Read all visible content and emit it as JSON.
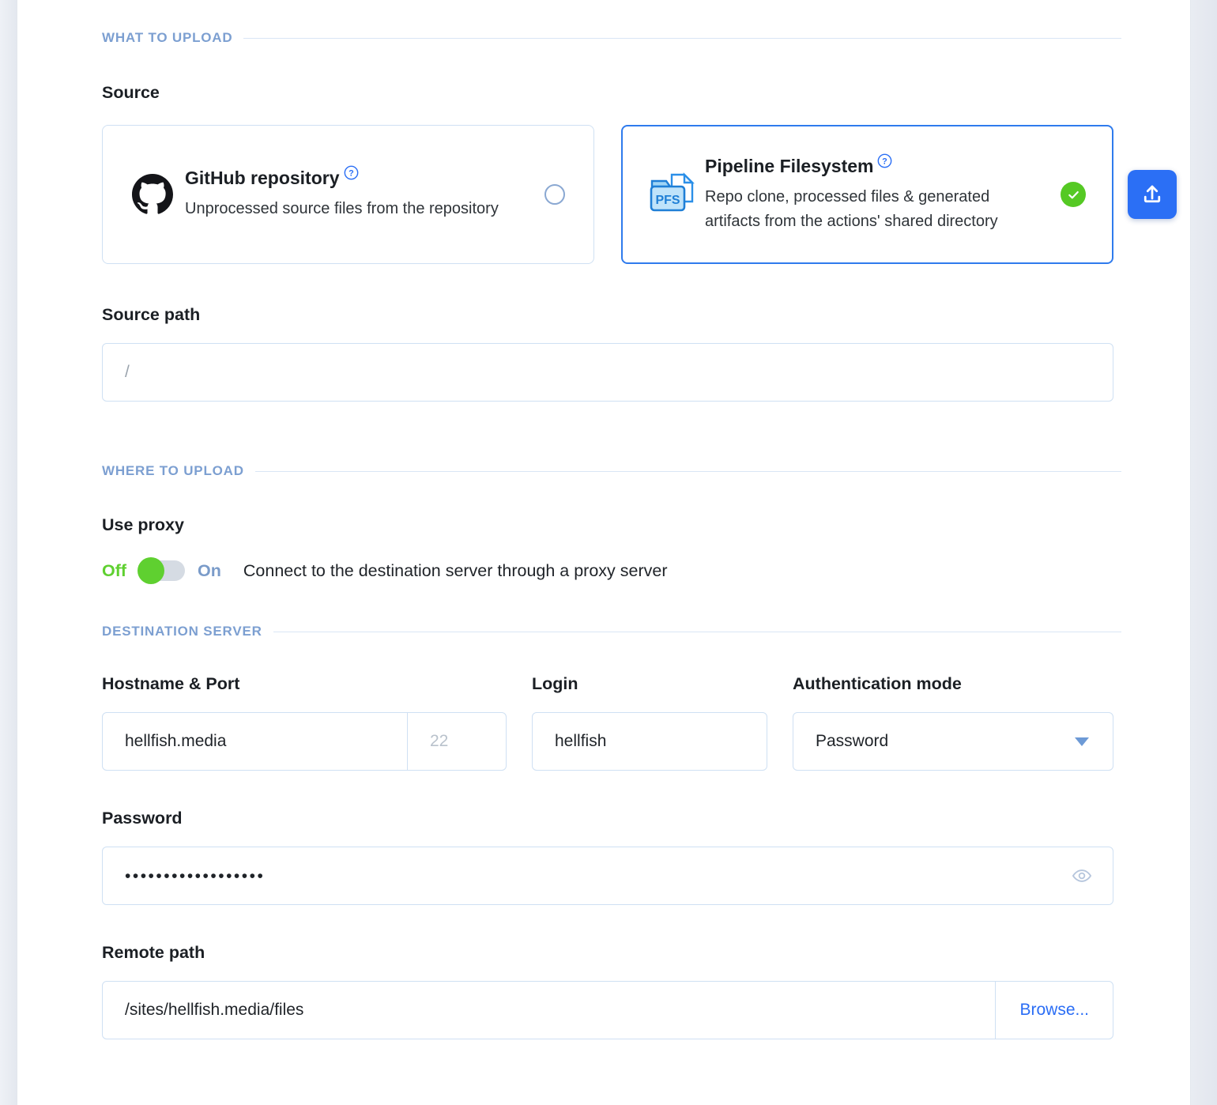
{
  "sections": {
    "what_to_upload": "WHAT TO UPLOAD",
    "where_to_upload": "WHERE TO UPLOAD",
    "destination_server": "DESTINATION SERVER"
  },
  "source": {
    "label": "Source",
    "options": [
      {
        "title": "GitHub repository",
        "description": "Unprocessed source files from the repository",
        "icon": "github-icon",
        "help_icon": "help-circle-icon",
        "selected": false,
        "state_icon": "radio-unchecked-icon"
      },
      {
        "title": "Pipeline Filesystem",
        "description": "Repo clone, processed files & generated artifacts from the actions' shared directory",
        "icon": "pfs-folder-icon",
        "icon_text": "PFS",
        "help_icon": "help-circle-icon",
        "selected": true,
        "state_icon": "check-circle-icon"
      }
    ]
  },
  "source_path": {
    "label": "Source path",
    "value": "",
    "placeholder": "/"
  },
  "upload_button": {
    "icon": "upload-icon",
    "color": "#2b6ff5"
  },
  "use_proxy": {
    "label": "Use proxy",
    "off_label": "Off",
    "on_label": "On",
    "state": "off",
    "description": "Connect to the destination server through a proxy server"
  },
  "hostname_port": {
    "label": "Hostname & Port",
    "host_value": "hellfish.media",
    "port_value": "",
    "port_placeholder": "22"
  },
  "login": {
    "label": "Login",
    "value": "hellfish"
  },
  "auth_mode": {
    "label": "Authentication mode",
    "value": "Password",
    "caret_icon": "chevron-down-icon"
  },
  "password": {
    "label": "Password",
    "value": "••••••••••••••••••",
    "reveal_icon": "eye-icon"
  },
  "remote_path": {
    "label": "Remote path",
    "value": "/sites/hellfish.media/files",
    "browse_label": "Browse..."
  },
  "colors": {
    "accent_blue": "#2b6ff5",
    "section_label": "#7c9fd1",
    "toggle_green": "#5fd030",
    "check_green": "#55c924",
    "border_blue": "#cfe0f3"
  }
}
